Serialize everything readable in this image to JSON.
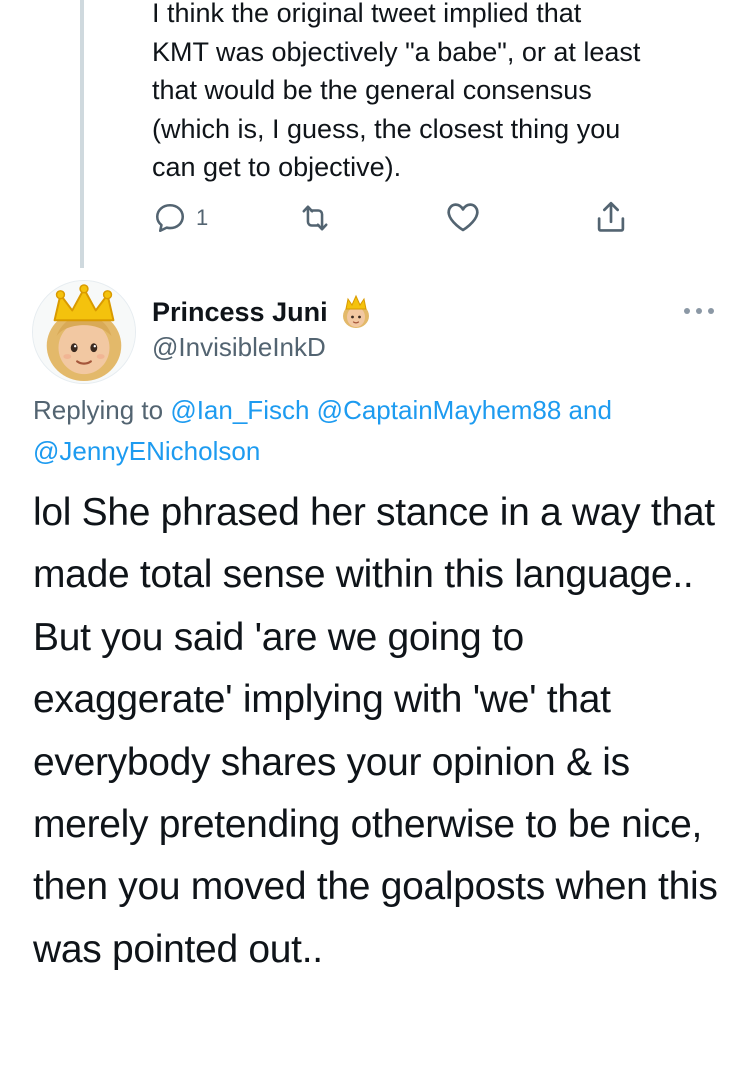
{
  "previous_tweet": {
    "text": "I think the original tweet implied that\nKMT was objectively \"a babe\", or at least\nthat would be the general consensus\n(which is, I guess, the closest thing you\ncan get to objective).",
    "actions": {
      "reply_count": "1",
      "reply_icon": "reply-bubble-icon",
      "retweet_icon": "retweet-icon",
      "like_icon": "heart-icon",
      "share_icon": "share-icon"
    }
  },
  "tweet": {
    "author": {
      "display_name": "Princess Juni",
      "handle": "@InvisibleInkD",
      "name_emoji": "princess-emoji",
      "avatar": "princess-avatar"
    },
    "more_icon": "more-dots-icon",
    "replying": {
      "prefix": "Replying to",
      "mention_1": "@Ian_Fisch",
      "mention_2": "@CaptainMayhem88",
      "conjunction": "and",
      "mention_3": "@JennyENicholson"
    },
    "text": "lol She phrased her stance in a way that made total sense within this language.. But you said 'are we going to exaggerate' implying with 'we' that everybody shares your opinion & is merely pretending otherwise to be nice, then you moved the goalposts when this was pointed out.."
  },
  "colors": {
    "link": "#1d9bf0",
    "muted": "#536471",
    "text": "#0f1419",
    "thread_line": "#cfd9de"
  }
}
